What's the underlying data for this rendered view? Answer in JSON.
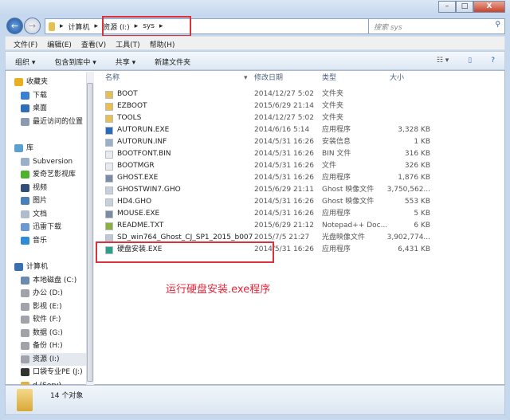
{
  "window": {
    "min": "–",
    "max": "□",
    "close": "X"
  },
  "address": {
    "crumbs": [
      "计算机",
      "资源 (I:)",
      "sys"
    ]
  },
  "search": {
    "placeholder": "搜索 sys"
  },
  "menu": [
    "文件(F)",
    "编辑(E)",
    "查看(V)",
    "工具(T)",
    "帮助(H)"
  ],
  "toolbar": [
    "组织 ▾",
    "包含到库中 ▾",
    "共享 ▾",
    "新建文件夹"
  ],
  "columns": {
    "name": "名称",
    "date": "修改日期",
    "type": "类型",
    "size": "大小"
  },
  "nav": [
    {
      "label": "收藏夹",
      "icon": "star-icon",
      "color": "#e8b020",
      "level": 0
    },
    {
      "label": "下载",
      "icon": "download-folder-icon",
      "color": "#3b7fd0",
      "level": 1
    },
    {
      "label": "桌面",
      "icon": "desktop-icon",
      "color": "#2f6db8",
      "level": 1
    },
    {
      "label": "最近访问的位置",
      "icon": "recent-icon",
      "color": "#8a9ab0",
      "level": 1
    },
    {
      "label": "库",
      "icon": "library-icon",
      "color": "#5aa0d0",
      "level": 0,
      "gap": true
    },
    {
      "label": "Subversion",
      "icon": "document-library-icon",
      "color": "#9ab0c8",
      "level": 1
    },
    {
      "label": "爱奇艺影视库",
      "icon": "iqiyi-icon",
      "color": "#50b030",
      "level": 1
    },
    {
      "label": "视频",
      "icon": "video-icon",
      "color": "#2f4f7a",
      "level": 1
    },
    {
      "label": "图片",
      "icon": "pictures-icon",
      "color": "#4a80b8",
      "level": 1
    },
    {
      "label": "文档",
      "icon": "documents-icon",
      "color": "#b0bccb",
      "level": 1
    },
    {
      "label": "迅雷下载",
      "icon": "thunder-download-icon",
      "color": "#6a9ad0",
      "level": 1
    },
    {
      "label": "音乐",
      "icon": "music-icon",
      "color": "#2f8ad8",
      "level": 1
    },
    {
      "label": "计算机",
      "icon": "computer-icon",
      "color": "#3a70b0",
      "level": 0,
      "gap": true
    },
    {
      "label": "本地磁盘 (C:)",
      "icon": "system-drive-icon",
      "color": "#6b8ab0",
      "level": 1
    },
    {
      "label": "办公 (D:)",
      "icon": "drive-icon",
      "color": "#a0a4aa",
      "level": 1
    },
    {
      "label": "影视 (E:)",
      "icon": "drive-icon",
      "color": "#a0a4aa",
      "level": 1
    },
    {
      "label": "软件 (F:)",
      "icon": "drive-icon",
      "color": "#a0a4aa",
      "level": 1
    },
    {
      "label": "数据 (G:)",
      "icon": "drive-icon",
      "color": "#a0a4aa",
      "level": 1
    },
    {
      "label": "备份 (H:)",
      "icon": "drive-icon",
      "color": "#a0a4aa",
      "level": 1
    },
    {
      "label": "资源 (I:)",
      "icon": "drive-icon",
      "color": "#a0a4aa",
      "level": 1,
      "selected": true
    },
    {
      "label": "口袋专业PE (J:)",
      "icon": "usb-drive-icon",
      "color": "#333333",
      "level": 1
    },
    {
      "label": "d (Serv)",
      "icon": "network-folder-icon",
      "color": "#e0b040",
      "level": 1
    }
  ],
  "files": [
    {
      "name": "BOOT",
      "date": "2014/12/27 5:02",
      "type": "文件夹",
      "size": "",
      "icon": "folder-icon",
      "color": "#e8c050"
    },
    {
      "name": "EZBOOT",
      "date": "2015/6/29 21:14",
      "type": "文件夹",
      "size": "",
      "icon": "folder-icon",
      "color": "#e8c050"
    },
    {
      "name": "TOOLS",
      "date": "2014/12/27 5:02",
      "type": "文件夹",
      "size": "",
      "icon": "folder-icon",
      "color": "#e8c050"
    },
    {
      "name": "AUTORUN.EXE",
      "date": "2014/6/16 5:14",
      "type": "应用程序",
      "size": "3,328 KB",
      "icon": "autorun-exe-icon",
      "color": "#2a6ab8"
    },
    {
      "name": "AUTORUN.INF",
      "date": "2014/5/31 16:26",
      "type": "安装信息",
      "size": "1 KB",
      "icon": "inf-file-icon",
      "color": "#9ab0c8"
    },
    {
      "name": "BOOTFONT.BIN",
      "date": "2014/5/31 16:26",
      "type": "BIN 文件",
      "size": "316 KB",
      "icon": "file-icon",
      "color": "#e8eaee"
    },
    {
      "name": "BOOTMGR",
      "date": "2014/5/31 16:26",
      "type": "文件",
      "size": "326 KB",
      "icon": "file-icon",
      "color": "#e8eaee"
    },
    {
      "name": "GHOST.EXE",
      "date": "2014/5/31 16:26",
      "type": "应用程序",
      "size": "1,876 KB",
      "icon": "exe-icon",
      "color": "#7a8ca4"
    },
    {
      "name": "GHOSTWIN7.GHO",
      "date": "2015/6/29 21:11",
      "type": "Ghost 映像文件",
      "size": "3,750,562...",
      "icon": "gho-file-icon",
      "color": "#c8d0dc"
    },
    {
      "name": "HD4.GHO",
      "date": "2014/5/31 16:26",
      "type": "Ghost 映像文件",
      "size": "553 KB",
      "icon": "gho-file-icon",
      "color": "#c8d0dc"
    },
    {
      "name": "MOUSE.EXE",
      "date": "2014/5/31 16:26",
      "type": "应用程序",
      "size": "5 KB",
      "icon": "exe-icon",
      "color": "#7a8ca4"
    },
    {
      "name": "README.TXT",
      "date": "2015/6/29 21:12",
      "type": "Notepad++ Doc...",
      "size": "6 KB",
      "icon": "notepad-file-icon",
      "color": "#8ab040"
    },
    {
      "name": "SD_win764_Ghost_CJ_SP1_2015_b007",
      "date": "2015/7/5 21:27",
      "type": "光盘映像文件",
      "size": "3,902,774...",
      "icon": "iso-file-icon",
      "color": "#c0c8d4"
    },
    {
      "name": "硬盘安装.EXE",
      "date": "2014/5/31 16:26",
      "type": "应用程序",
      "size": "6,431 KB",
      "icon": "installer-exe-icon",
      "color": "#2aa08a"
    }
  ],
  "status": {
    "count": "14 个对象"
  },
  "annotation": "运行硬盘安装.exe程序"
}
